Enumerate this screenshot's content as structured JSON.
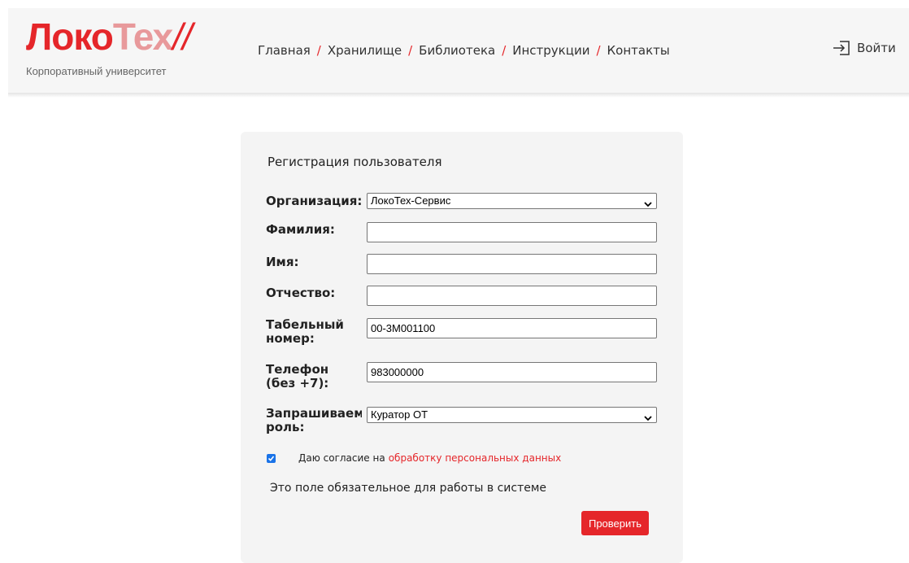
{
  "logo": {
    "brand_part1": "Локо",
    "brand_part2": "Тех",
    "brand_slash": "//",
    "subtitle": "Корпоративный университет"
  },
  "nav": {
    "items": [
      "Главная",
      "Хранилище",
      "Библиотека",
      "Инструкции",
      "Контакты"
    ],
    "separator": "/"
  },
  "login": {
    "label": "Войти",
    "icon": "login-icon"
  },
  "form": {
    "title": "Регистрация пользователя",
    "organization": {
      "label": "Организация:",
      "value": "ЛокоТех-Сервис"
    },
    "lastname": {
      "label": "Фамилия:",
      "value": ""
    },
    "firstname": {
      "label": "Имя:",
      "value": ""
    },
    "patronymic": {
      "label": "Отчество:",
      "value": ""
    },
    "employee_number": {
      "label": "Табельный номер:",
      "value": "00-3М001100"
    },
    "phone": {
      "label": "Телефон (без +7):",
      "value": "983000000"
    },
    "role": {
      "label": "Запрашиваемая роль:",
      "value": "Куратор ОТ"
    },
    "consent": {
      "checked": true,
      "text": "Даю согласие на",
      "link": "обработку персональных данных"
    },
    "note": "Это поле обязательное для работы в системе",
    "submit_label": "Проверить"
  },
  "colors": {
    "accent": "#e5262a",
    "card_bg": "#f4f4f4",
    "header_bg": "#f6f6f6",
    "checkbox": "#1a73e8"
  }
}
